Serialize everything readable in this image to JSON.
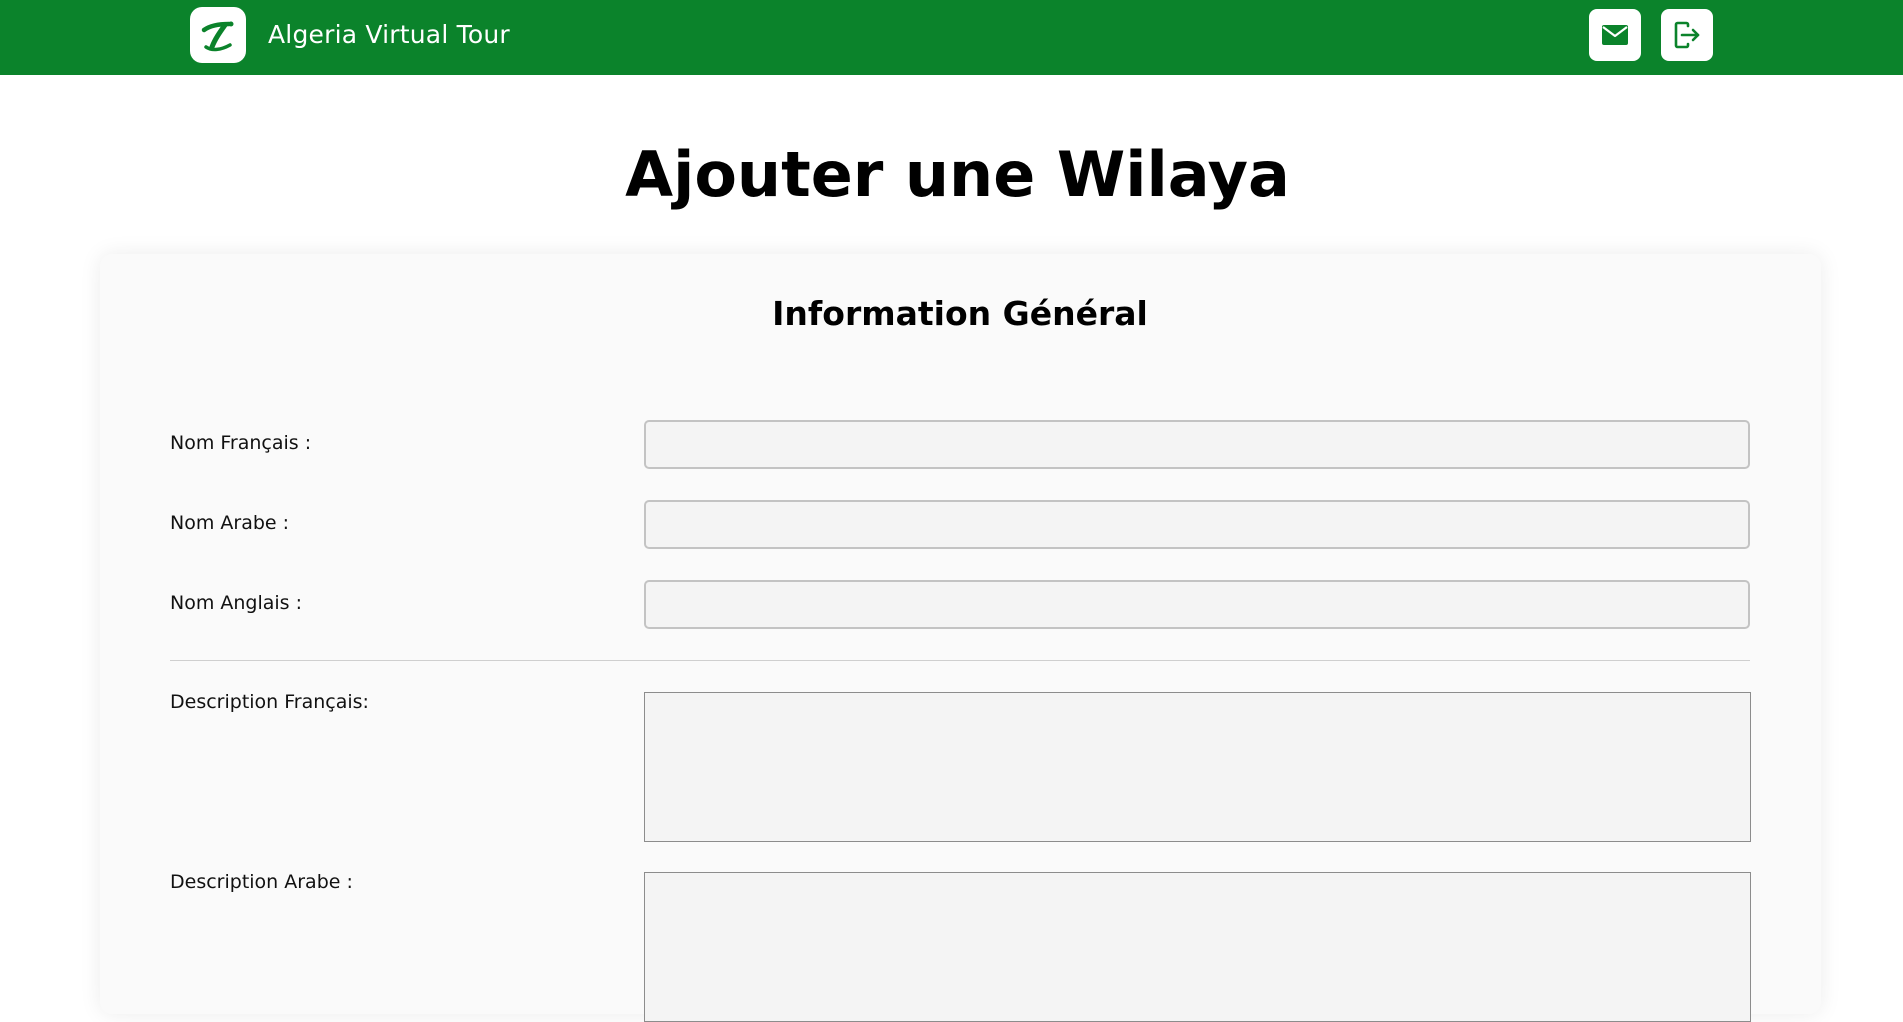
{
  "header": {
    "app_title": "Algeria Virtual Tour",
    "logo_icon": "algeria-virtual-tour-logo",
    "mail_icon": "envelope-icon",
    "logout_icon": "logout-icon",
    "bar_color": "#0b832b"
  },
  "page": {
    "title": "Ajouter une Wilaya"
  },
  "form": {
    "section_title": "Information Général",
    "fields": {
      "nom_francais": {
        "label": "Nom Français :",
        "value": ""
      },
      "nom_arabe": {
        "label": "Nom Arabe :",
        "value": ""
      },
      "nom_anglais": {
        "label": "Nom Anglais :",
        "value": ""
      },
      "description_francais": {
        "label": "Description Français:",
        "value": ""
      },
      "description_arabe": {
        "label": "Description Arabe :",
        "value": ""
      }
    }
  }
}
